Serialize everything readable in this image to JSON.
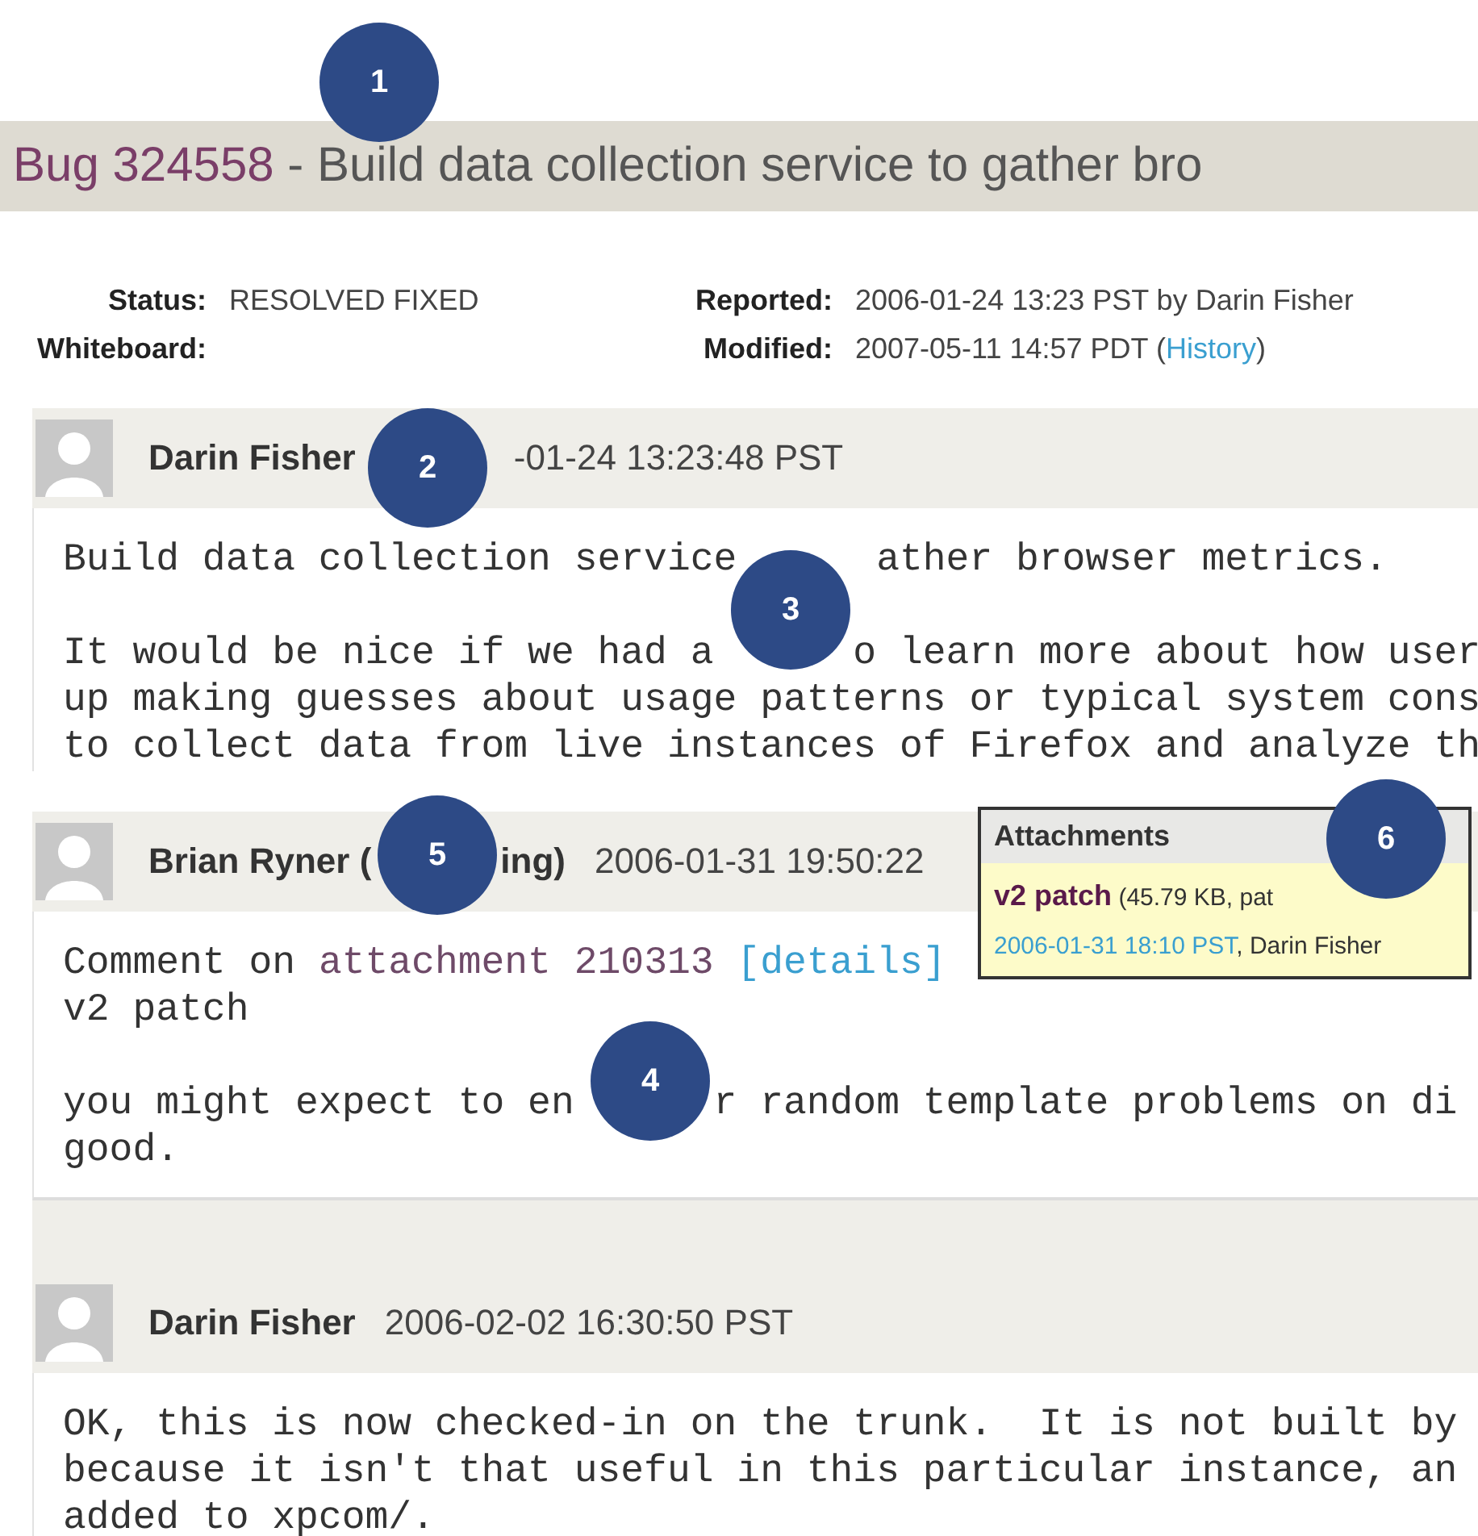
{
  "title": {
    "bug_id": "Bug 324558",
    "summary": " - Build data collection service to gather bro"
  },
  "fields": [
    {
      "label": "Status:",
      "value": [
        {
          "kind": "text",
          "text": "RESOLVED FIXED"
        }
      ]
    },
    {
      "label": "Reported:",
      "value": [
        {
          "kind": "text",
          "text": "2006-01-24 13:23 PST by Darin Fisher"
        }
      ]
    },
    {
      "label": "Whiteboard:"
    },
    {
      "label": "Modified:",
      "value": [
        {
          "kind": "text",
          "text": "2007-05-11 14:57 PDT ("
        },
        {
          "kind": "link",
          "text": "History"
        },
        {
          "kind": "text",
          "text": ")"
        }
      ]
    }
  ],
  "comments": [
    {
      "header": [
        {
          "kind": "author",
          "text": "Darin Fisher"
        },
        {
          "kind": "gap"
        },
        {
          "kind": "date",
          "text": "-01-24 13:23:48 PST"
        }
      ],
      "lines": [
        {
          "kind": "text",
          "segments": [
            {
              "kind": "text",
              "text": "Build data collection service"
            },
            {
              "kind": "gap"
            },
            {
              "kind": "text",
              "text": "ather browser metrics."
            }
          ]
        },
        {
          "kind": "blank"
        },
        {
          "kind": "text",
          "segments": [
            {
              "kind": "text",
              "text": "It would be nice if we had a"
            },
            {
              "kind": "gap"
            },
            {
              "kind": "text",
              "text": "o learn more about how user"
            }
          ]
        },
        {
          "kind": "text",
          "segments": [
            {
              "kind": "text",
              "text": "up making guesses about usage patterns or typical system cons"
            }
          ]
        },
        {
          "kind": "text",
          "segments": [
            {
              "kind": "text",
              "text": "to collect data from live instances of Firefox and analyze th"
            }
          ]
        }
      ]
    },
    {
      "header": [
        {
          "kind": "author",
          "text": "Brian Ryner ("
        },
        {
          "kind": "gap"
        },
        {
          "kind": "author",
          "text": "ing)"
        },
        {
          "kind": "date",
          "text": "2006-01-31 19:50:22"
        }
      ],
      "lines": [
        {
          "kind": "text",
          "segments": [
            {
              "kind": "text",
              "text": "Comment on "
            },
            {
              "kind": "visited_link",
              "text": "attachment 210313"
            },
            {
              "kind": "link",
              "text": "[details]"
            }
          ]
        },
        {
          "kind": "text",
          "segments": [
            {
              "kind": "text",
              "text": "v2 patch"
            }
          ]
        },
        {
          "kind": "blank"
        },
        {
          "kind": "text",
          "segments": [
            {
              "kind": "text",
              "text": "you might expect to en"
            },
            {
              "kind": "gap"
            },
            {
              "kind": "text",
              "text": "r random template problems on di"
            }
          ]
        },
        {
          "kind": "text",
          "segments": [
            {
              "kind": "text",
              "text": "good."
            }
          ]
        }
      ]
    },
    {
      "header": [
        {
          "kind": "author",
          "text": "Darin Fisher"
        },
        {
          "kind": "date",
          "text": "2006-02-02 16:30:50 PST"
        }
      ],
      "lines": [
        {
          "kind": "text",
          "segments": [
            {
              "kind": "text",
              "text": "OK, this is now checked-in on the trunk.  It is not built by"
            }
          ]
        },
        {
          "kind": "text",
          "segments": [
            {
              "kind": "text",
              "text": "because it isn't that useful in this particular instance, an"
            }
          ]
        },
        {
          "kind": "text",
          "segments": [
            {
              "kind": "text",
              "text": "added to xpcom/."
            }
          ]
        }
      ]
    }
  ],
  "attachments_popup": {
    "title": "Attachments",
    "name": "v2 patch",
    "size": "(45.79 KB, pat",
    "date": "2006-01-31 18:10 PST",
    "author": ", Darin Fisher"
  },
  "callouts": [
    "1",
    "2",
    "3",
    "4",
    "5",
    "6"
  ]
}
